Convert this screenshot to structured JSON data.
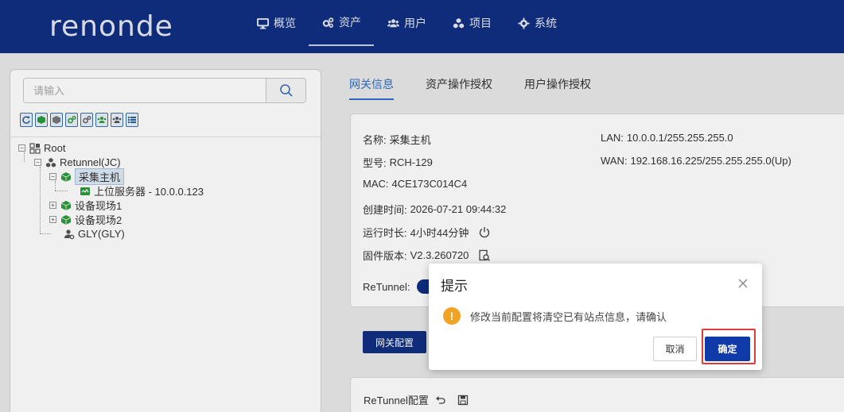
{
  "header": {
    "logo": "renonde",
    "nav": [
      {
        "label": "概览",
        "icon": "monitor-icon"
      },
      {
        "label": "资产",
        "icon": "gears-icon",
        "active": true
      },
      {
        "label": "用户",
        "icon": "users-icon"
      },
      {
        "label": "项目",
        "icon": "cubes-icon"
      },
      {
        "label": "系统",
        "icon": "gear-icon"
      }
    ]
  },
  "sidebar": {
    "search_placeholder": "请输入",
    "tree": {
      "root": "Root",
      "retunnel": "Retunnel(JC)",
      "collector": "采集主机",
      "upper_server": "上位服务器 - 10.0.0.123",
      "site1": "设备现场1",
      "site2": "设备现场2",
      "gly": "GLY(GLY)"
    }
  },
  "tabs": [
    {
      "label": "网关信息",
      "active": true
    },
    {
      "label": "资产操作授权"
    },
    {
      "label": "用户操作授权"
    }
  ],
  "gateway_info": {
    "name_label": "名称:",
    "name_value": "采集主机",
    "model_label": "型号:",
    "model_value": "RCH-129",
    "mac_label": "MAC:",
    "mac_value": "4CE173C014C4",
    "created_label": "创建时间:",
    "created_value": "2026-07-21 09:44:32",
    "uptime_label": "运行时长:",
    "uptime_value": "4小时44分钟",
    "firmware_label": "固件版本:",
    "firmware_value": "V2.3.260720",
    "retunnel_label": "ReTunnel:",
    "lan_label": "LAN:",
    "lan_value": "10.0.0.1/255.255.255.0",
    "wan_label": "WAN:",
    "wan_value": "192.168.16.225/255.255.255.0(Up)"
  },
  "gateway_config_button": "网关配置",
  "retunnel_config_title": "ReTunnel配置",
  "dialog": {
    "title": "提示",
    "message": "修改当前配置将清空已有站点信息，请确认",
    "cancel": "取消",
    "confirm": "确定"
  },
  "colors": {
    "header_bg": "#0f2f82",
    "accent": "#2f6fc7",
    "confirm_bg": "#0f3aa8",
    "warn": "#f0a324",
    "highlight": "#e23b3b"
  }
}
